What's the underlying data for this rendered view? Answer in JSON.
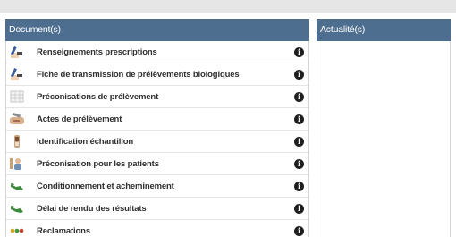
{
  "documents_panel": {
    "title": "Document(s)",
    "items": [
      {
        "label": "Renseignements prescriptions",
        "icon": "hand-writing-icon"
      },
      {
        "label": "Fiche de transmission de prélèvements biologiques",
        "icon": "hand-writing-icon"
      },
      {
        "label": "Préconisations de prélèvement",
        "icon": "table-sheet-icon"
      },
      {
        "label": "Actes de prélèvement",
        "icon": "syringe-arm-icon"
      },
      {
        "label": "Identification échantillon",
        "icon": "sample-tube-icon"
      },
      {
        "label": "Préconisation pour les patients",
        "icon": "person-icon"
      },
      {
        "label": "Conditionnement et acheminement",
        "icon": "hand-shake-icon"
      },
      {
        "label": "Délai de rendu des résultats",
        "icon": "hand-shake-icon"
      },
      {
        "label": "Reclamations",
        "icon": "traffic-dots-icon"
      }
    ],
    "info_glyph": "i"
  },
  "news_panel": {
    "title": "Actualité(s)"
  },
  "colors": {
    "header_bg": "#4d6e8f",
    "header_text": "#ffffff",
    "row_text": "#2f2f2f",
    "info_icon_bg": "#1f1f1f"
  }
}
